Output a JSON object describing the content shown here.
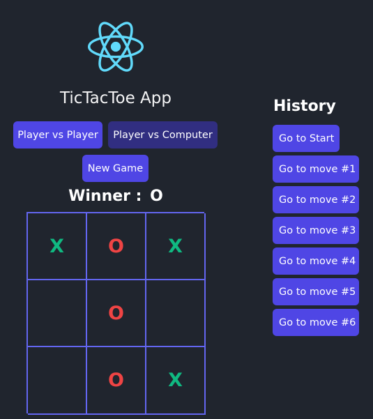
{
  "header": {
    "logo_icon": "react-atom-icon",
    "title": "TicTacToe App"
  },
  "controls": {
    "player_vs_player": "Player vs Player",
    "player_vs_computer": "Player vs Computer",
    "new_game": "New Game"
  },
  "status": {
    "label": "Winner :",
    "winner": "O"
  },
  "board": {
    "cells": [
      "X",
      "O",
      "X",
      "",
      "O",
      "",
      "",
      "O",
      "X"
    ]
  },
  "history": {
    "title": "History",
    "moves": [
      "Go to Start",
      "Go to move #1",
      "Go to move #2",
      "Go to move #3",
      "Go to move #4",
      "Go to move #5",
      "Go to move #6"
    ]
  },
  "colors": {
    "background": "#20252e",
    "primary": "#4f46e5",
    "dark_button": "#312e81",
    "board_lines": "#6366f1",
    "x_color": "#10b981",
    "o_color": "#ef4444",
    "logo": "#61dafb"
  }
}
